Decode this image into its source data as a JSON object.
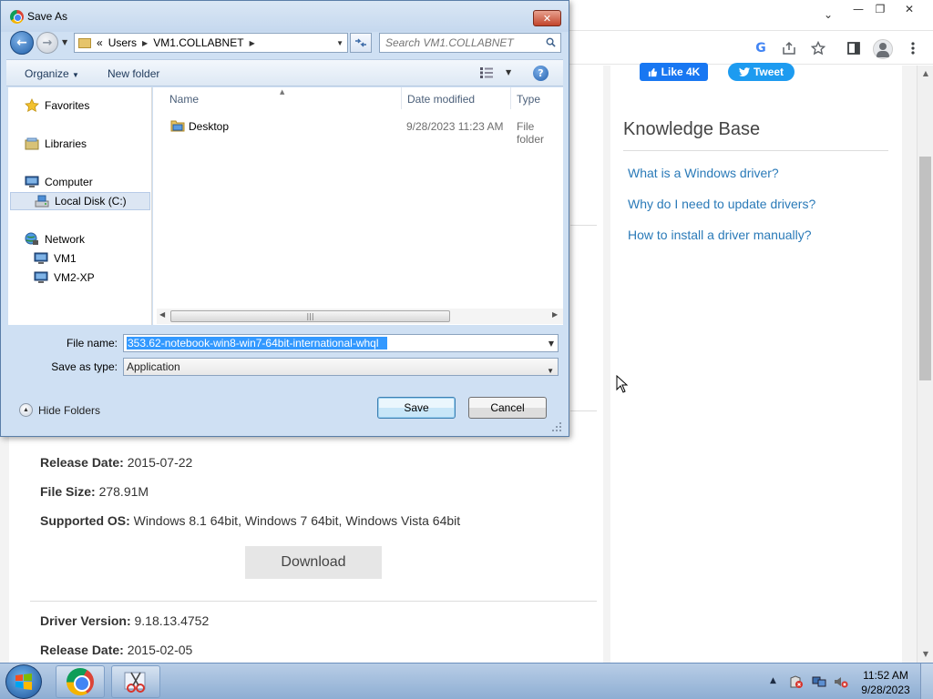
{
  "browser": {
    "minimize_glyph": "—",
    "restore_glyph": "❐",
    "close_glyph": "✕",
    "tab_dropdown_glyph": "⌄",
    "google_letter": "G",
    "social": {
      "like_label": "Like 4K",
      "tweet_label": "Tweet"
    },
    "knowledge_base": {
      "title": "Knowledge Base",
      "links": [
        "What is a Windows driver?",
        "Why do I need to update drivers?",
        "How to install a driver manually?"
      ]
    },
    "drivers": [
      {
        "release_label": "Release Date:",
        "release_date": "2015-07-22",
        "size_label": "File Size:",
        "size": "278.91M",
        "os_label": "Supported OS:",
        "os": "Windows 8.1 64bit, Windows 7 64bit, Windows Vista 64bit",
        "download_label": "Download"
      },
      {
        "version_label": "Driver Version:",
        "version": "9.18.13.4752",
        "release_label": "Release Date:",
        "release_date": "2015-02-05"
      }
    ]
  },
  "dialog": {
    "title": "Save As",
    "close_glyph": "✕",
    "breadcrumb": {
      "prefix": "«",
      "items": [
        "Users",
        "VM1.COLLABNET"
      ]
    },
    "search_placeholder": "Search VM1.COLLABNET",
    "toolbar": {
      "organize": "Organize",
      "new_folder": "New folder",
      "help": "?"
    },
    "nav": {
      "favorites": "Favorites",
      "libraries": "Libraries",
      "computer": "Computer",
      "local_disk": "Local Disk (C:)",
      "network": "Network",
      "vm1": "VM1",
      "vm2": "VM2-XP"
    },
    "columns": {
      "name": "Name",
      "date": "Date modified",
      "type": "Type"
    },
    "files": [
      {
        "name": "Desktop",
        "date": "9/28/2023 11:23 AM",
        "type": "File folder"
      }
    ],
    "file_name_label": "File name:",
    "file_name": "353.62-notebook-win8-win7-64bit-international-whql",
    "save_type_label": "Save as type:",
    "save_type": "Application",
    "hide_folders": "Hide Folders",
    "save_button": "Save",
    "cancel_button": "Cancel"
  },
  "taskbar": {
    "time": "11:52 AM",
    "date": "9/28/2023"
  },
  "colors": {
    "link": "#2a7ab8",
    "selection": "#3399ff",
    "facebook": "#1877f2",
    "twitter": "#1d9bf0"
  }
}
